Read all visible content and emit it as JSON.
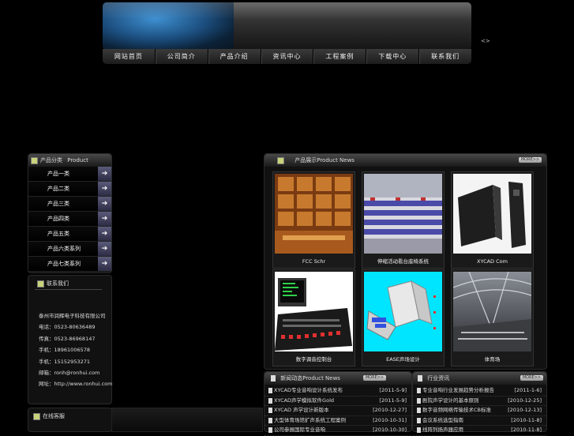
{
  "header": {
    "side_marker": "<>"
  },
  "nav": [
    "网站首页",
    "公司简介",
    "产品介绍",
    "资讯中心",
    "工程案例",
    "下载中心",
    "联系我们"
  ],
  "categories": {
    "title": "产品分类",
    "title_en": "Product",
    "items": [
      "产品一类",
      "产品二类",
      "产品三类",
      "产品四类",
      "产品五类",
      "产品六类系列",
      "产品七类系列"
    ]
  },
  "contact": {
    "title": "联系我们",
    "lines": [
      "泰州市润辉电子科技有限公司",
      "电话：0523-80636489",
      "传真：0523-86968147",
      "手机：18961006578",
      "手机：15152953271",
      "邮箱：ronh@ronhui.com",
      "网址：http://www.ronhui.com"
    ]
  },
  "bottom_left": {
    "title": "在线客服"
  },
  "showcase": {
    "title": "产品展示Product News",
    "more": "MORE>>",
    "items": [
      {
        "caption": "FCC Schr",
        "icon": "wood-ceiling-photo"
      },
      {
        "caption": "伸缩活动看台座椅系统",
        "icon": "stadium-seats-photo"
      },
      {
        "caption": "XYCAD Com",
        "icon": "speaker-cabinet-photo"
      },
      {
        "caption": "数字调音控制台",
        "icon": "mixing-console-photo"
      },
      {
        "caption": "EASE声场设计",
        "icon": "cad-model-render"
      },
      {
        "caption": "体育场",
        "icon": "stadium-interior-photo"
      }
    ]
  },
  "news_left": {
    "title": "新闻动态Product News",
    "more": "MORE>>",
    "rows": [
      {
        "title": "XYCAD专业音响设计系统发布",
        "date": "[2011-5-9]"
      },
      {
        "title": "XYCAD声学模拟软件Gold",
        "date": "[2011-5-9]"
      },
      {
        "title": "XYCAD 声学设计新版本",
        "date": "[2010-12-27]"
      },
      {
        "title": "大型体育场馆扩声系统工程案例",
        "date": "[2010-10-31]"
      },
      {
        "title": "公司参展国际专业音响",
        "date": "[2010-10-30]"
      }
    ]
  },
  "news_right": {
    "title": "行业资讯",
    "more": "MORE>>",
    "rows": [
      {
        "title": "专业音响行业发展趋势分析报告",
        "date": "[2011-1-6]"
      },
      {
        "title": "剧院声学设计的基本原则",
        "date": "[2010-12-25]"
      },
      {
        "title": "数字音频网络传输技术CB标准",
        "date": "[2010-12-13]"
      },
      {
        "title": "会议系统选型指南",
        "date": "[2010-11-8]"
      },
      {
        "title": "线阵列扬声器应用",
        "date": "[2010-11-8]"
      }
    ]
  },
  "colors": {
    "background": "#000000",
    "banner_blue": "#2a6fae",
    "arrow_button": "#3c3c5c"
  }
}
